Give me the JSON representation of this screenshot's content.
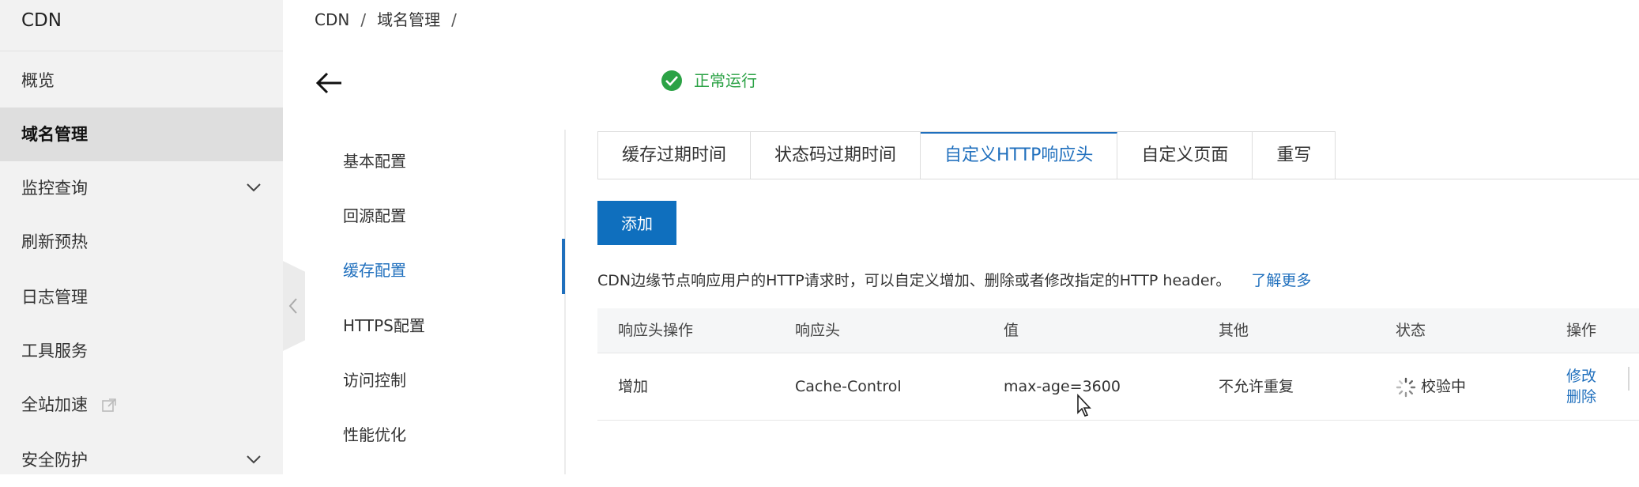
{
  "sidebar": {
    "title": "CDN",
    "items": [
      {
        "label": "概览"
      },
      {
        "label": "域名管理"
      },
      {
        "label": "监控查询"
      },
      {
        "label": "刷新预热"
      },
      {
        "label": "日志管理"
      },
      {
        "label": "工具服务"
      },
      {
        "label": "全站加速"
      },
      {
        "label": "安全防护"
      }
    ]
  },
  "breadcrumb": {
    "items": [
      "CDN",
      "域名管理"
    ],
    "separator": "/"
  },
  "header": {
    "status": "正常运行",
    "status_color": "#2ba245"
  },
  "subnav": {
    "items": [
      "基本配置",
      "回源配置",
      "缓存配置",
      "HTTPS配置",
      "访问控制",
      "性能优化"
    ]
  },
  "tabs": [
    "缓存过期时间",
    "状态码过期时间",
    "自定义HTTP响应头",
    "自定义页面",
    "重写"
  ],
  "add_button": "添加",
  "description": {
    "text": "CDN边缘节点响应用户的HTTP请求时，可以自定义增加、删除或者修改指定的HTTP header。",
    "link": "了解更多"
  },
  "table": {
    "headers": [
      "响应头操作",
      "响应头",
      "值",
      "其他",
      "状态",
      "操作"
    ],
    "rows": [
      {
        "operation": "增加",
        "header": "Cache-Control",
        "value": "max-age=3600",
        "other": "不允许重复",
        "status": "校验中",
        "actions": [
          "修改",
          "删除"
        ]
      }
    ]
  },
  "colors": {
    "accent": "#1f6fbd",
    "button": "#0f6fbe",
    "sidebar_bg": "#f2f2f2",
    "sidebar_active": "#dedede"
  },
  "icons": [
    "chevron-down-icon",
    "external-link-icon",
    "chevron-left-icon",
    "back-arrow-icon",
    "check-circle-icon",
    "spinner-icon",
    "mouse-cursor-icon"
  ]
}
